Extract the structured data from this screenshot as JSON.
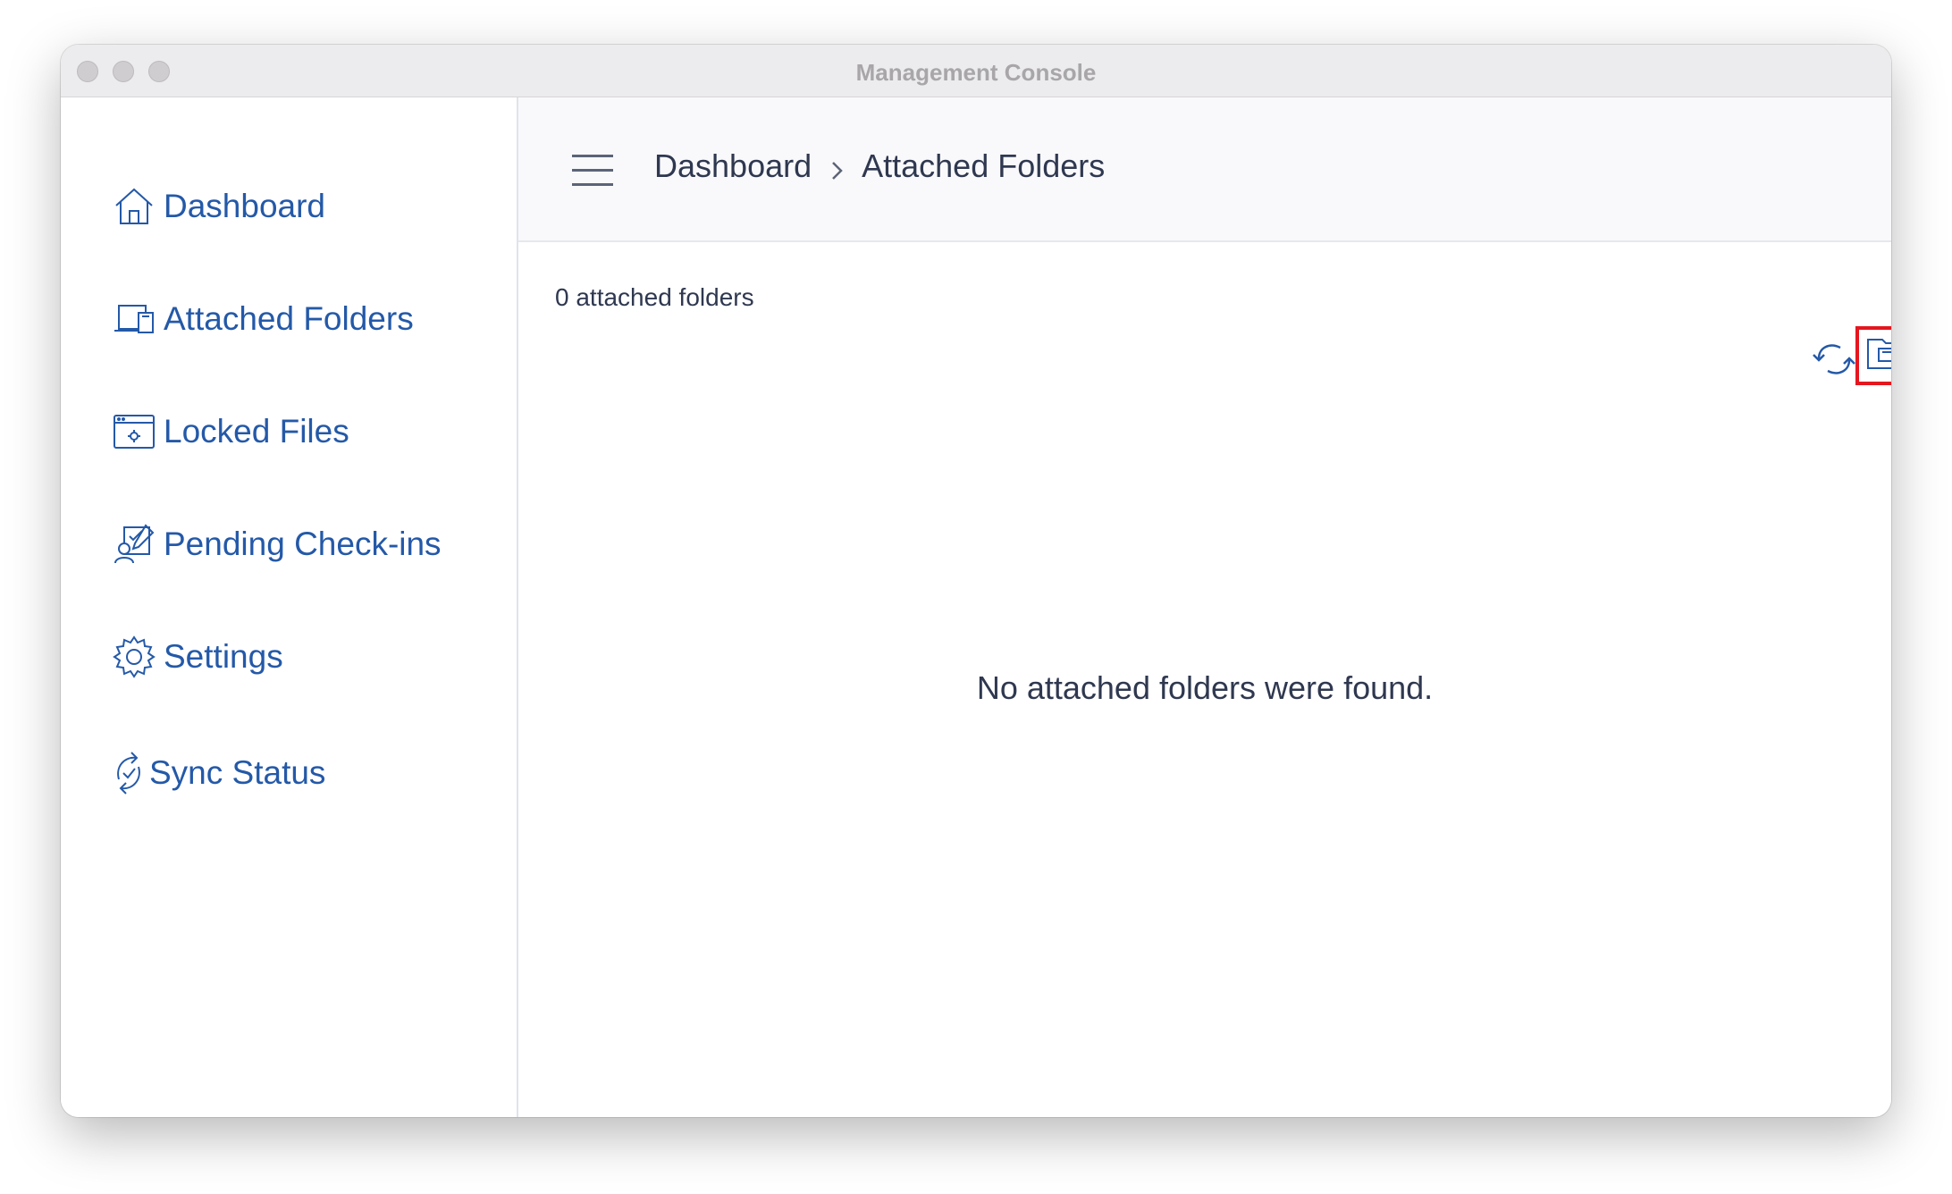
{
  "window": {
    "title": "Management Console"
  },
  "sidebar": {
    "items": [
      {
        "label": "Dashboard",
        "icon": "home-icon"
      },
      {
        "label": "Attached Folders",
        "icon": "attached-folders-icon"
      },
      {
        "label": "Locked Files",
        "icon": "locked-files-icon"
      },
      {
        "label": "Pending Check-ins",
        "icon": "pending-checkins-icon"
      },
      {
        "label": "Settings",
        "icon": "gear-icon"
      },
      {
        "label": "Sync Status",
        "icon": "sync-status-icon"
      }
    ]
  },
  "header": {
    "breadcrumb": [
      "Dashboard",
      "Attached Folders"
    ]
  },
  "main": {
    "count_text": "0 attached folders",
    "empty_message": "No attached folders were found."
  },
  "colors": {
    "accent": "#2459a8",
    "highlight": "#e5161e",
    "text": "#2f3850"
  }
}
